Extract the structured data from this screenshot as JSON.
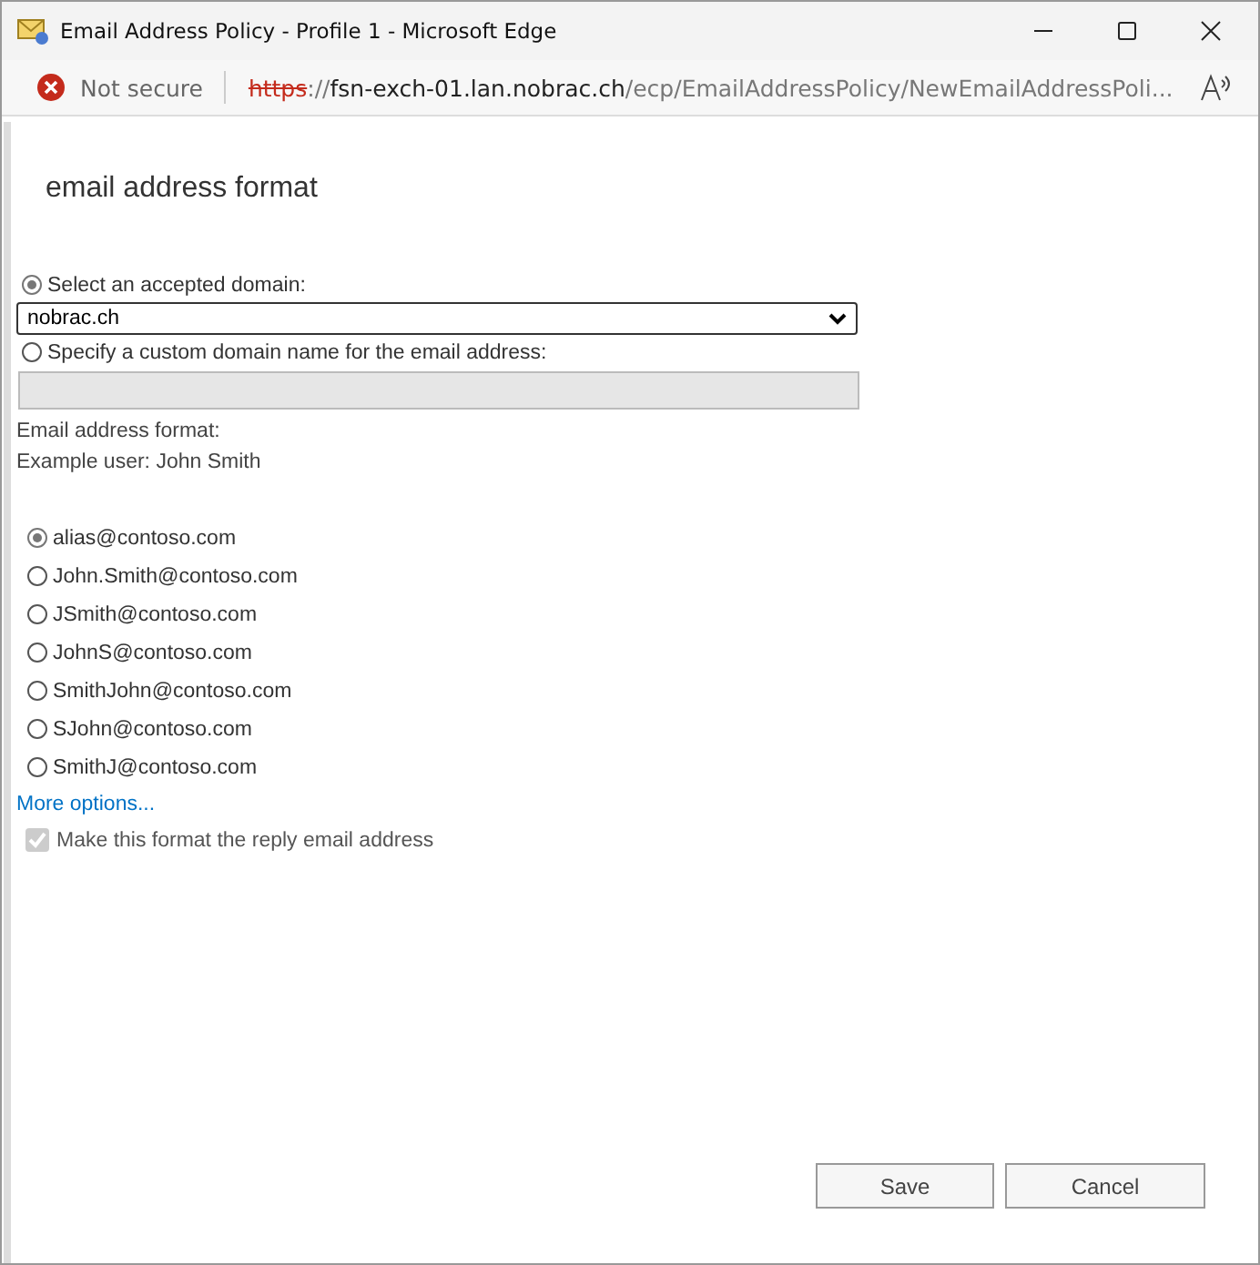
{
  "window": {
    "title": "Email Address Policy - Profile 1 - Microsoft Edge"
  },
  "address_bar": {
    "security": "Not secure",
    "url": [
      {
        "kind": "struck",
        "text": "https"
      },
      {
        "kind": "plain",
        "text": "://"
      },
      {
        "kind": "host",
        "text": "fsn-exch-01.lan.nobrac.ch"
      },
      {
        "kind": "plain",
        "text": "/ecp/EmailAddressPolicy/NewEmailAddressPoli..."
      }
    ]
  },
  "heading": "email address format",
  "domain_choice": [
    {
      "label": "Select an accepted domain:",
      "selected": true,
      "kind": "select",
      "value": "nobrac.ch",
      "disabled": false
    },
    {
      "label": "Specify a custom domain name for the email address:",
      "selected": false,
      "kind": "input",
      "disabled": true
    }
  ],
  "format_label": "Email address format:",
  "example": "Example user: John Smith",
  "formats": [
    {
      "label": "alias@contoso.com",
      "selected": true
    },
    {
      "label": "John.Smith@contoso.com",
      "selected": false
    },
    {
      "label": "JSmith@contoso.com",
      "selected": false
    },
    {
      "label": "JohnS@contoso.com",
      "selected": false
    },
    {
      "label": "SmithJohn@contoso.com",
      "selected": false
    },
    {
      "label": "SJohn@contoso.com",
      "selected": false
    },
    {
      "label": "SmithJ@contoso.com",
      "selected": false
    }
  ],
  "more_link": "More options...",
  "reply_checkbox": {
    "label": "Make this format the reply email address",
    "checked": true,
    "disabled": true
  },
  "buttons": [
    "Save",
    "Cancel"
  ]
}
